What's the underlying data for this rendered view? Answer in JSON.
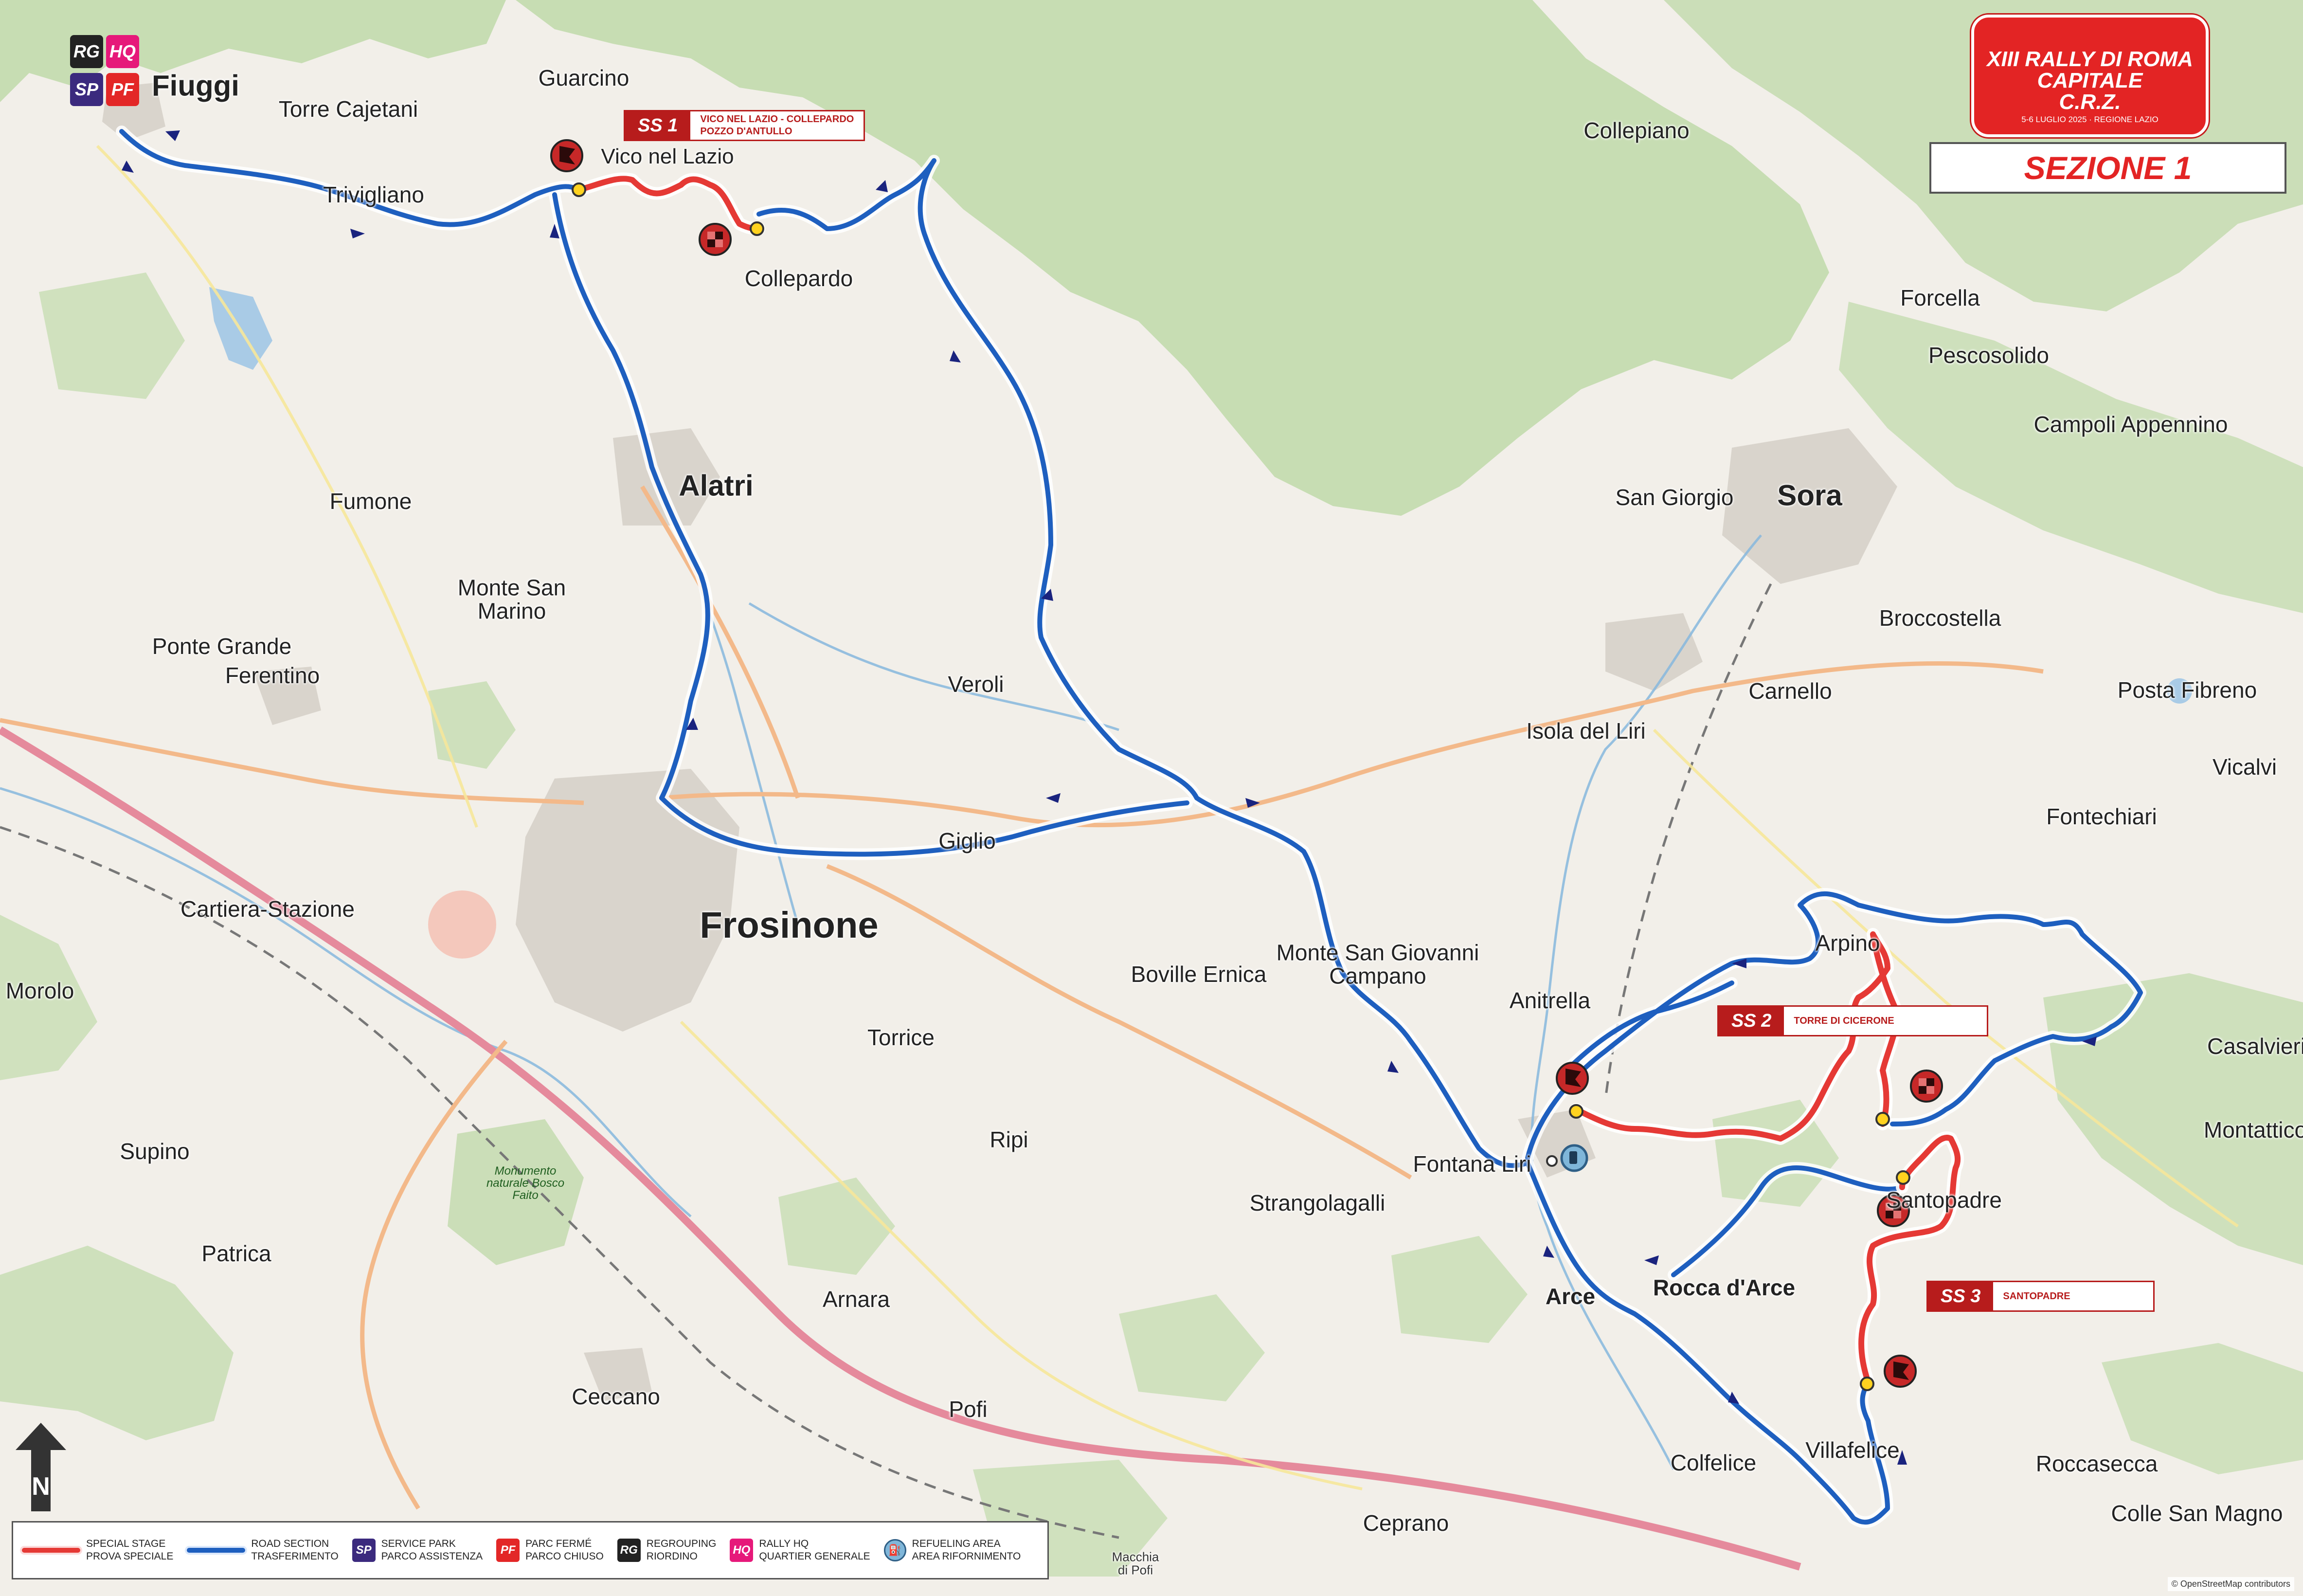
{
  "logo": {
    "title": "XIII RALLY DI ROMA CAPITALE",
    "sub_brand": "C.R.Z.",
    "date": "5-6 LUGLIO 2025",
    "region": "REGIONE LAZIO"
  },
  "section_label": "SEZIONE 1",
  "start_badges": [
    "RG",
    "HQ",
    "SP",
    "PF"
  ],
  "start_town": "Fiuggi",
  "towns": [
    {
      "name": "Guarcino",
      "size": "mid"
    },
    {
      "name": "Torre Cajetani",
      "size": "mid"
    },
    {
      "name": "Trivigliano",
      "size": "mid"
    },
    {
      "name": "Vico nel Lazio",
      "size": "big_plain"
    },
    {
      "name": "Collepardo",
      "size": "mid"
    },
    {
      "name": "Collepiano",
      "size": "mid"
    },
    {
      "name": "Forcella",
      "size": "mid"
    },
    {
      "name": "Pescosolido",
      "size": "mid"
    },
    {
      "name": "Campoli Appennino",
      "size": "mid"
    },
    {
      "name": "San Giorgio",
      "size": "mid"
    },
    {
      "name": "Sora",
      "size": "big"
    },
    {
      "name": "Broccostella",
      "size": "mid"
    },
    {
      "name": "Carnello",
      "size": "mid"
    },
    {
      "name": "Posta Fibreno",
      "size": "mid"
    },
    {
      "name": "Isola del Liri",
      "size": "mid"
    },
    {
      "name": "Vicalvi",
      "size": "mid"
    },
    {
      "name": "Fontechiari",
      "size": "mid"
    },
    {
      "name": "Alatri",
      "size": "big"
    },
    {
      "name": "Fumone",
      "size": "mid"
    },
    {
      "name": "Monte San Marino",
      "size": "mid"
    },
    {
      "name": "Ponte Grande",
      "size": "mid"
    },
    {
      "name": "Ferentino",
      "size": "mid"
    },
    {
      "name": "Veroli",
      "size": "mid"
    },
    {
      "name": "Giglio",
      "size": "mid"
    },
    {
      "name": "Cartiera-Stazione",
      "size": "mid"
    },
    {
      "name": "Frosinone",
      "size": "huge"
    },
    {
      "name": "Morolo",
      "size": "mid"
    },
    {
      "name": "Boville Ernica",
      "size": "mid"
    },
    {
      "name": "Monte San Giovanni Campano",
      "size": "mid"
    },
    {
      "name": "Anitrella",
      "size": "mid"
    },
    {
      "name": "Arpino",
      "size": "mid"
    },
    {
      "name": "Casalvieri",
      "size": "mid"
    },
    {
      "name": "Torrice",
      "size": "mid"
    },
    {
      "name": "Supino",
      "size": "mid"
    },
    {
      "name": "Ripi",
      "size": "mid"
    },
    {
      "name": "Fontana Liri",
      "size": "mid"
    },
    {
      "name": "Montattico",
      "size": "mid"
    },
    {
      "name": "Strangolagalli",
      "size": "mid"
    },
    {
      "name": "Santopadre",
      "size": "mid"
    },
    {
      "name": "Patrica",
      "size": "mid"
    },
    {
      "name": "Arnara",
      "size": "mid"
    },
    {
      "name": "Arce",
      "size": "big_plain"
    },
    {
      "name": "Rocca d'Arce",
      "size": "big_plain"
    },
    {
      "name": "Ceccano",
      "size": "mid"
    },
    {
      "name": "Pofi",
      "size": "mid"
    },
    {
      "name": "Villafelice",
      "size": "mid"
    },
    {
      "name": "Colfelice",
      "size": "mid"
    },
    {
      "name": "Roccasecca",
      "size": "mid"
    },
    {
      "name": "Colle San Magno",
      "size": "mid"
    },
    {
      "name": "Ceprano",
      "size": "mid"
    },
    {
      "name": "Macchia di Pofi",
      "size": "small"
    }
  ],
  "park_label": "Monumento naturale Bosco Faito",
  "stages": [
    {
      "code": "SS 1",
      "line1": "VICO NEL LAZIO - COLLEPARDO",
      "line2": "POZZO D'ANTULLO"
    },
    {
      "code": "SS 2",
      "line1": "TORRE DI CICERONE",
      "line2": ""
    },
    {
      "code": "SS 3",
      "line1": "SANTOPADRE",
      "line2": ""
    }
  ],
  "legend": [
    {
      "key": "special-stage",
      "line1": "SPECIAL STAGE",
      "line2": "PROVA SPECIALE",
      "color": "#e53935"
    },
    {
      "key": "road-section",
      "line1": "ROAD SECTION",
      "line2": "TRASFERIMENTO",
      "color": "#1e5fbf"
    },
    {
      "key": "service-park",
      "badge": "SP",
      "line1": "SERVICE PARK",
      "line2": "PARCO ASSISTENZA",
      "color": "#3b2a7e"
    },
    {
      "key": "parc-ferme",
      "badge": "PF",
      "line1": "PARC FERMÉ",
      "line2": "PARCO CHIUSO",
      "color": "#e32727"
    },
    {
      "key": "regrouping",
      "badge": "RG",
      "line1": "REGROUPING",
      "line2": "RIORDINO",
      "color": "#222222"
    },
    {
      "key": "rally-hq",
      "badge": "HQ",
      "line1": "RALLY HQ",
      "line2": "QUARTIER GENERALE",
      "color": "#e6197a"
    },
    {
      "key": "refueling",
      "line1": "REFUELING AREA",
      "line2": "AREA RIFORNIMENTO",
      "color": "#7fb6d9"
    }
  ],
  "north_label": "N",
  "attribution": "© OpenStreetMap contributors",
  "colors": {
    "road_section": "#1e5fbf",
    "special_stage": "#e53935",
    "stage_flag": "#c62828",
    "land": "#f2efe9",
    "forest": "#c4dcb0",
    "urban": "#d9d4cc",
    "water": "#a9cbe6"
  }
}
